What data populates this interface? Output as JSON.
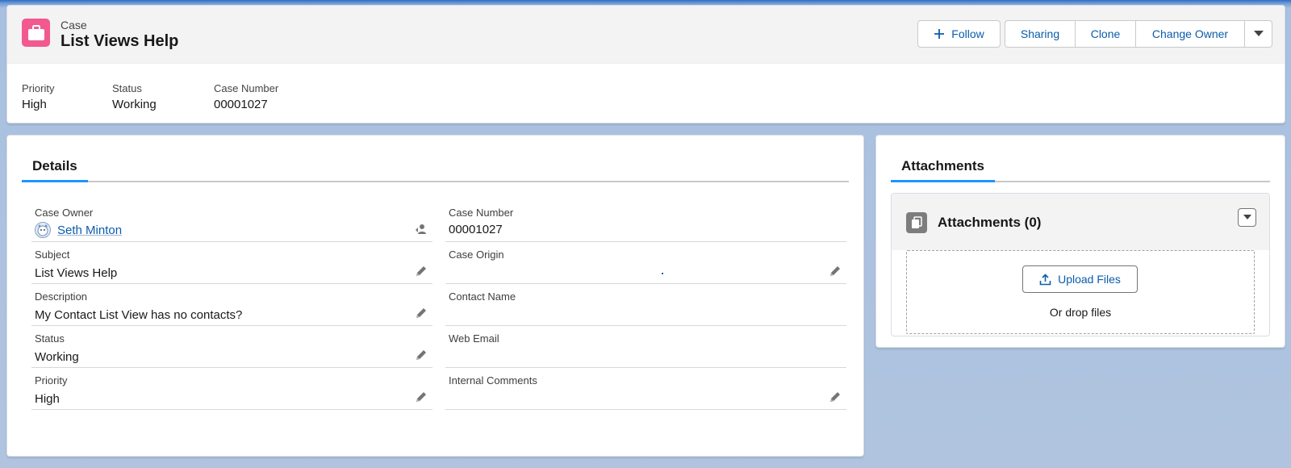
{
  "record": {
    "object_type": "Case",
    "title": "List Views Help",
    "icon": "briefcase-icon",
    "accent_color": "#f2598e"
  },
  "actions": {
    "follow_label": "Follow",
    "sharing_label": "Sharing",
    "clone_label": "Clone",
    "change_owner_label": "Change Owner"
  },
  "highlights": [
    {
      "label": "Priority",
      "value": "High"
    },
    {
      "label": "Status",
      "value": "Working"
    },
    {
      "label": "Case Number",
      "value": "00001027"
    }
  ],
  "details": {
    "tab_label": "Details",
    "left_fields": [
      {
        "label": "Case Owner",
        "value": "Seth Minton"
      },
      {
        "label": "Subject",
        "value": "List Views Help"
      },
      {
        "label": "Description",
        "value": "My Contact List View has no contacts?"
      },
      {
        "label": "Status",
        "value": "Working"
      },
      {
        "label": "Priority",
        "value": "High"
      }
    ],
    "right_fields": [
      {
        "label": "Case Number",
        "value": "00001027"
      },
      {
        "label": "Case Origin",
        "value": ""
      },
      {
        "label": "Contact Name",
        "value": ""
      },
      {
        "label": "Web Email",
        "value": ""
      },
      {
        "label": "Internal Comments",
        "value": ""
      }
    ]
  },
  "attachments": {
    "tab_label": "Attachments",
    "title": "Attachments (0)",
    "upload_label": "Upload Files",
    "drop_text": "Or drop files"
  },
  "colors": {
    "link": "#0b5cab",
    "tab_indicator": "#1b96ff",
    "background": "#b0c4df"
  }
}
